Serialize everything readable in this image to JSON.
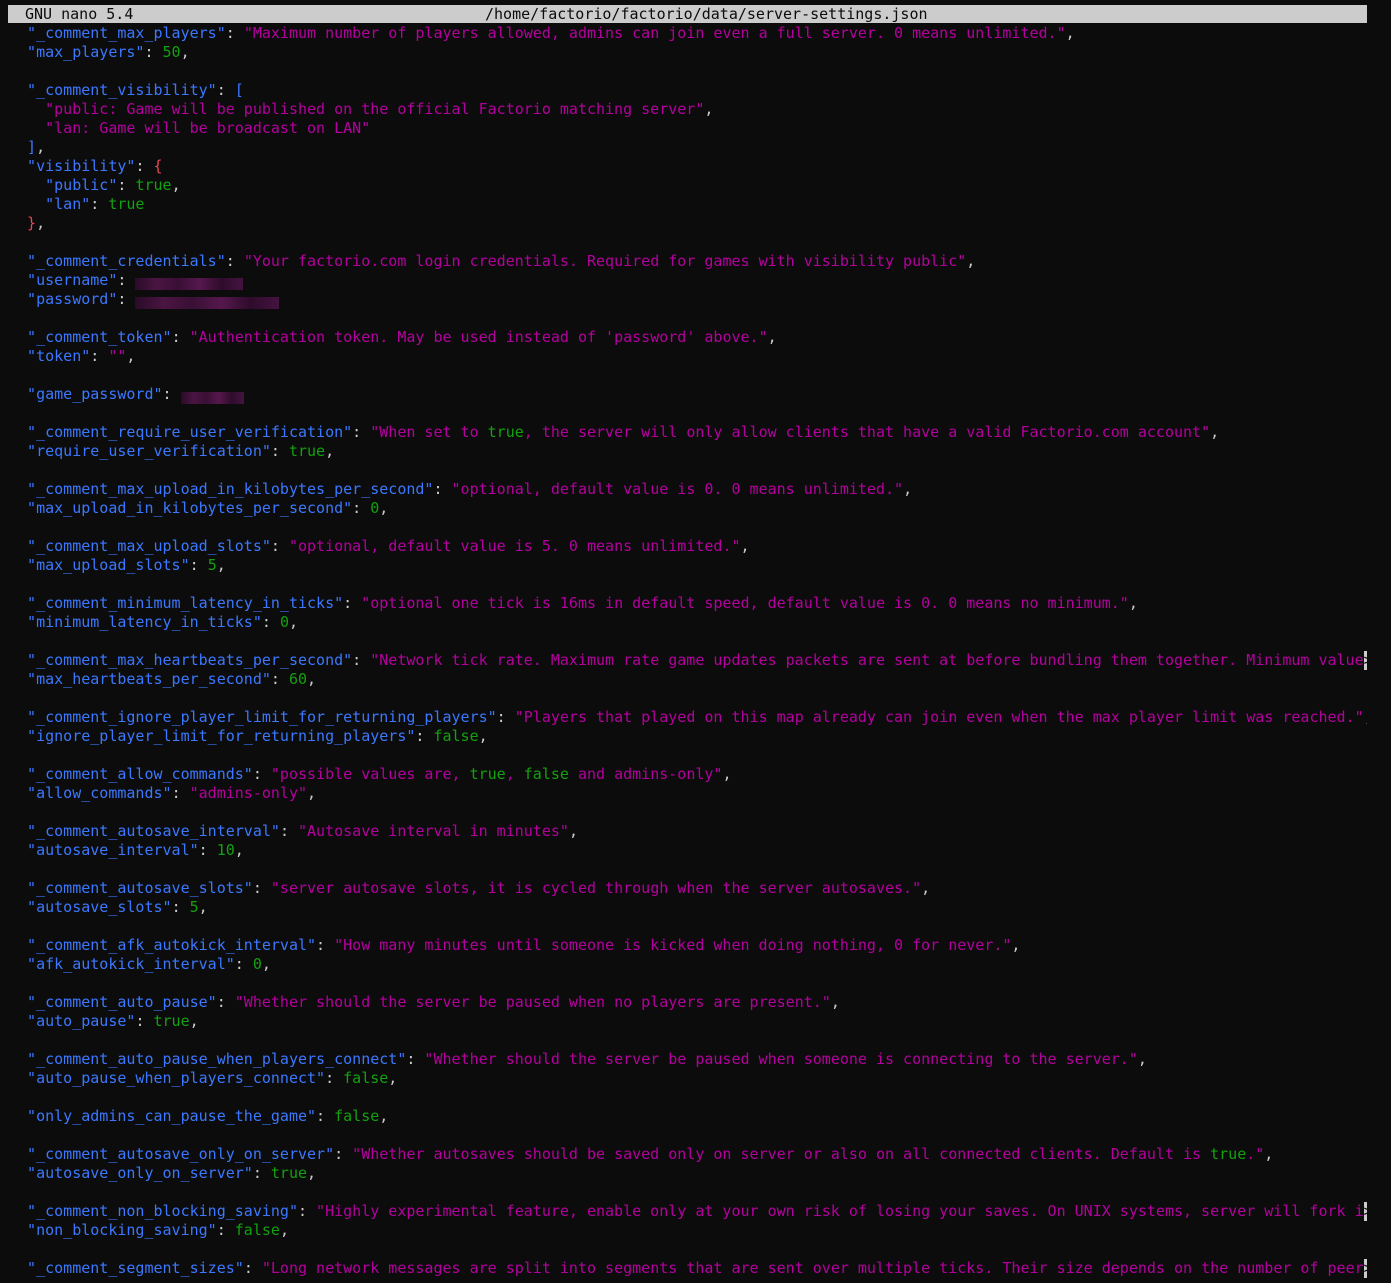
{
  "titlebar": {
    "app_version": "GNU nano 5.4",
    "file_path": "/home/factorio/factorio/data/server-settings.json"
  },
  "colors": {
    "background": "#0c0c0c",
    "key": "#3b78ff",
    "string": "#b4009e",
    "literal": "#13a10e",
    "punctuation": "#cccccc",
    "bracket": "#e74856",
    "titlebar_bg": "#cccccc"
  },
  "lines": [
    [
      [
        "k",
        "  \"_comment_max_players\""
      ],
      [
        "p",
        ": "
      ],
      [
        "s",
        "\"Maximum number of players allowed, admins can join even a full server. 0 means unlimited.\""
      ],
      [
        "p",
        ","
      ]
    ],
    [
      [
        "k",
        "  \"max_players\""
      ],
      [
        "p",
        ": "
      ],
      [
        "v",
        "50"
      ],
      [
        "p",
        ","
      ]
    ],
    [],
    [
      [
        "k",
        "  \"_comment_visibility\""
      ],
      [
        "p",
        ": "
      ],
      [
        "k",
        "["
      ]
    ],
    [
      [
        "s",
        "    \"public: Game will be published on the official Factorio matching server\""
      ],
      [
        "p",
        ","
      ]
    ],
    [
      [
        "s",
        "    \"lan: Game will be broadcast on LAN\""
      ]
    ],
    [
      [
        "k",
        "  ]"
      ],
      [
        "p",
        ","
      ]
    ],
    [
      [
        "k",
        "  \"visibility\""
      ],
      [
        "p",
        ": "
      ],
      [
        "b",
        "{"
      ]
    ],
    [
      [
        "k",
        "    \"public\""
      ],
      [
        "p",
        ": "
      ],
      [
        "v",
        "true"
      ],
      [
        "p",
        ","
      ]
    ],
    [
      [
        "k",
        "    \"lan\""
      ],
      [
        "p",
        ": "
      ],
      [
        "v",
        "true"
      ]
    ],
    [
      [
        "b",
        "  }"
      ],
      [
        "p",
        ","
      ]
    ],
    [],
    [
      [
        "k",
        "  \"_comment_credentials\""
      ],
      [
        "p",
        ": "
      ],
      [
        "s",
        "\"Your factorio.com login credentials. Required for games with visibility public\""
      ],
      [
        "p",
        ","
      ]
    ],
    [
      [
        "k",
        "  \"username\""
      ],
      [
        "p",
        ": "
      ],
      [
        "r",
        "username"
      ]
    ],
    [
      [
        "k",
        "  \"password\""
      ],
      [
        "p",
        ": "
      ],
      [
        "r",
        "password"
      ]
    ],
    [],
    [
      [
        "k",
        "  \"_comment_token\""
      ],
      [
        "p",
        ": "
      ],
      [
        "s",
        "\"Authentication token. May be used instead of 'password' above.\""
      ],
      [
        "p",
        ","
      ]
    ],
    [
      [
        "k",
        "  \"token\""
      ],
      [
        "p",
        ": "
      ],
      [
        "s",
        "\"\""
      ],
      [
        "p",
        ","
      ]
    ],
    [],
    [
      [
        "k",
        "  \"game_password\""
      ],
      [
        "p",
        ": "
      ],
      [
        "r",
        "game_password"
      ]
    ],
    [],
    [
      [
        "k",
        "  \"_comment_require_user_verification\""
      ],
      [
        "p",
        ": "
      ],
      [
        "s",
        "\"When set to "
      ],
      [
        "v",
        "true"
      ],
      [
        "s",
        ", the server will only allow clients that have a valid Factorio.com account\""
      ],
      [
        "p",
        ","
      ]
    ],
    [
      [
        "k",
        "  \"require_user_verification\""
      ],
      [
        "p",
        ": "
      ],
      [
        "v",
        "true"
      ],
      [
        "p",
        ","
      ]
    ],
    [],
    [
      [
        "k",
        "  \"_comment_max_upload_in_kilobytes_per_second\""
      ],
      [
        "p",
        ": "
      ],
      [
        "s",
        "\"optional, default value is 0. 0 means unlimited.\""
      ],
      [
        "p",
        ","
      ]
    ],
    [
      [
        "k",
        "  \"max_upload_in_kilobytes_per_second\""
      ],
      [
        "p",
        ": "
      ],
      [
        "v",
        "0"
      ],
      [
        "p",
        ","
      ]
    ],
    [],
    [
      [
        "k",
        "  \"_comment_max_upload_slots\""
      ],
      [
        "p",
        ": "
      ],
      [
        "s",
        "\"optional, default value is 5. 0 means unlimited.\""
      ],
      [
        "p",
        ","
      ]
    ],
    [
      [
        "k",
        "  \"max_upload_slots\""
      ],
      [
        "p",
        ": "
      ],
      [
        "v",
        "5"
      ],
      [
        "p",
        ","
      ]
    ],
    [],
    [
      [
        "k",
        "  \"_comment_minimum_latency_in_ticks\""
      ],
      [
        "p",
        ": "
      ],
      [
        "s",
        "\"optional one tick is 16ms in default speed, default value is 0. 0 means no minimum.\""
      ],
      [
        "p",
        ","
      ]
    ],
    [
      [
        "k",
        "  \"minimum_latency_in_ticks\""
      ],
      [
        "p",
        ": "
      ],
      [
        "v",
        "0"
      ],
      [
        "p",
        ","
      ]
    ],
    [],
    [
      [
        "k",
        "  \"_comment_max_heartbeats_per_second\""
      ],
      [
        "p",
        ": "
      ],
      [
        "s",
        "\"Network tick rate. Maximum rate game updates packets are sent at before bundling them together. Minimum value"
      ],
      [
        "o",
        ">"
      ]
    ],
    [
      [
        "k",
        "  \"max_heartbeats_per_second\""
      ],
      [
        "p",
        ": "
      ],
      [
        "v",
        "60"
      ],
      [
        "p",
        ","
      ]
    ],
    [],
    [
      [
        "k",
        "  \"_comment_ignore_player_limit_for_returning_players\""
      ],
      [
        "p",
        ": "
      ],
      [
        "s",
        "\"Players that played on this map already can join even when the max player limit was reached.\""
      ],
      [
        "p",
        ","
      ]
    ],
    [
      [
        "k",
        "  \"ignore_player_limit_for_returning_players\""
      ],
      [
        "p",
        ": "
      ],
      [
        "v",
        "false"
      ],
      [
        "p",
        ","
      ]
    ],
    [],
    [
      [
        "k",
        "  \"_comment_allow_commands\""
      ],
      [
        "p",
        ": "
      ],
      [
        "s",
        "\"possible values are, "
      ],
      [
        "v",
        "true"
      ],
      [
        "s",
        ", "
      ],
      [
        "v",
        "false"
      ],
      [
        "s",
        " and admins-only\""
      ],
      [
        "p",
        ","
      ]
    ],
    [
      [
        "k",
        "  \"allow_commands\""
      ],
      [
        "p",
        ": "
      ],
      [
        "s",
        "\"admins-only\""
      ],
      [
        "p",
        ","
      ]
    ],
    [],
    [
      [
        "k",
        "  \"_comment_autosave_interval\""
      ],
      [
        "p",
        ": "
      ],
      [
        "s",
        "\"Autosave interval in minutes\""
      ],
      [
        "p",
        ","
      ]
    ],
    [
      [
        "k",
        "  \"autosave_interval\""
      ],
      [
        "p",
        ": "
      ],
      [
        "v",
        "10"
      ],
      [
        "p",
        ","
      ]
    ],
    [],
    [
      [
        "k",
        "  \"_comment_autosave_slots\""
      ],
      [
        "p",
        ": "
      ],
      [
        "s",
        "\"server autosave slots, it is cycled through when the server autosaves.\""
      ],
      [
        "p",
        ","
      ]
    ],
    [
      [
        "k",
        "  \"autosave_slots\""
      ],
      [
        "p",
        ": "
      ],
      [
        "v",
        "5"
      ],
      [
        "p",
        ","
      ]
    ],
    [],
    [
      [
        "k",
        "  \"_comment_afk_autokick_interval\""
      ],
      [
        "p",
        ": "
      ],
      [
        "s",
        "\"How many minutes until someone is kicked when doing nothing, 0 for never.\""
      ],
      [
        "p",
        ","
      ]
    ],
    [
      [
        "k",
        "  \"afk_autokick_interval\""
      ],
      [
        "p",
        ": "
      ],
      [
        "v",
        "0"
      ],
      [
        "p",
        ","
      ]
    ],
    [],
    [
      [
        "k",
        "  \"_comment_auto_pause\""
      ],
      [
        "p",
        ": "
      ],
      [
        "s",
        "\"Whether should the server be paused when no players are present.\""
      ],
      [
        "p",
        ","
      ]
    ],
    [
      [
        "k",
        "  \"auto_pause\""
      ],
      [
        "p",
        ": "
      ],
      [
        "v",
        "true"
      ],
      [
        "p",
        ","
      ]
    ],
    [],
    [
      [
        "k",
        "  \"_comment_auto_pause_when_players_connect\""
      ],
      [
        "p",
        ": "
      ],
      [
        "s",
        "\"Whether should the server be paused when someone is connecting to the server.\""
      ],
      [
        "p",
        ","
      ]
    ],
    [
      [
        "k",
        "  \"auto_pause_when_players_connect\""
      ],
      [
        "p",
        ": "
      ],
      [
        "v",
        "false"
      ],
      [
        "p",
        ","
      ]
    ],
    [],
    [
      [
        "k",
        "  \"only_admins_can_pause_the_game\""
      ],
      [
        "p",
        ": "
      ],
      [
        "v",
        "false"
      ],
      [
        "p",
        ","
      ]
    ],
    [],
    [
      [
        "k",
        "  \"_comment_autosave_only_on_server\""
      ],
      [
        "p",
        ": "
      ],
      [
        "s",
        "\"Whether autosaves should be saved only on server or also on all connected clients. Default is "
      ],
      [
        "v",
        "true"
      ],
      [
        "s",
        ".\""
      ],
      [
        "p",
        ","
      ]
    ],
    [
      [
        "k",
        "  \"autosave_only_on_server\""
      ],
      [
        "p",
        ": "
      ],
      [
        "v",
        "true"
      ],
      [
        "p",
        ","
      ]
    ],
    [],
    [
      [
        "k",
        "  \"_comment_non_blocking_saving\""
      ],
      [
        "p",
        ": "
      ],
      [
        "s",
        "\"Highly experimental feature, enable only at your own risk of losing your saves. On UNIX systems, server will fork i"
      ],
      [
        "o",
        ">"
      ]
    ],
    [
      [
        "k",
        "  \"non_blocking_saving\""
      ],
      [
        "p",
        ": "
      ],
      [
        "v",
        "false"
      ],
      [
        "p",
        ","
      ]
    ],
    [],
    [
      [
        "k",
        "  \"_comment_segment_sizes\""
      ],
      [
        "p",
        ": "
      ],
      [
        "s",
        "\"Long network messages are split into segments that are sent over multiple ticks. Their size depends on the number of peer"
      ],
      [
        "o",
        ">"
      ]
    ]
  ],
  "redacted": {
    "username": "redacted",
    "password": "redacted",
    "game_password": "redacted"
  },
  "redacted_widths": {
    "username": 12,
    "password": 16,
    "game_password": 7
  }
}
